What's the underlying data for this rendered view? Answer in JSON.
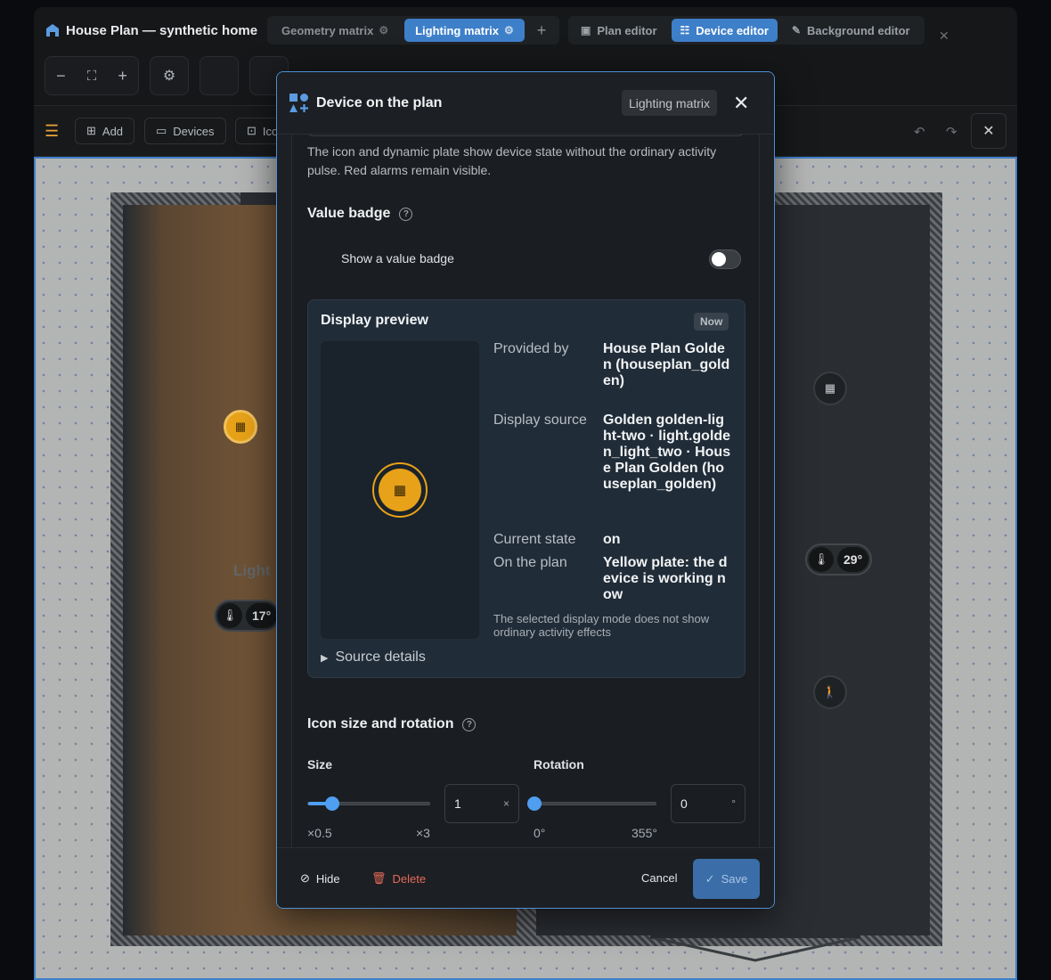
{
  "app": {
    "title": "House Plan — synthetic home",
    "matrix_tabs": [
      {
        "label": "Geometry matrix",
        "active": false
      },
      {
        "label": "Lighting matrix",
        "active": true
      }
    ],
    "modes": [
      {
        "label": "Plan editor",
        "active": false
      },
      {
        "label": "Device editor",
        "active": true
      },
      {
        "label": "Background editor",
        "active": false
      }
    ]
  },
  "toolbar": {
    "zoom_out": "−",
    "zoom_in": "+",
    "add_label": "Add",
    "devices_label": "Devices",
    "icons_label": "Icons"
  },
  "plan": {
    "room_label": "Light",
    "left_temp": "17°",
    "right_temp": "29°"
  },
  "modal": {
    "title": "Device on the plan",
    "chip": "Lighting matrix",
    "note": "The icon and dynamic plate show device state without the ordinary activity pulse. Red alarms remain visible.",
    "badge_section": "Value badge",
    "badge_toggle_label": "Show a value badge",
    "badge_toggle_on": false,
    "preview": {
      "title": "Display preview",
      "badge": "Now",
      "rows": [
        {
          "key": "Provided by",
          "value": "House Plan Golden (houseplan_golden)"
        },
        {
          "key": "Display source",
          "value": "Golden golden-light-two · light.golden_light_two · House Plan Golden (houseplan_golden)"
        },
        {
          "key": "Current state",
          "value": "on"
        },
        {
          "key": "On the plan",
          "value": "Yellow plate: the device is working now"
        }
      ],
      "note": "The selected display mode does not show ordinary activity effects",
      "details": "Source details"
    },
    "size_section": "Icon size and rotation",
    "size": {
      "label": "Size",
      "value": "1",
      "unit": "×",
      "min_label": "×0.5",
      "max_label": "×3",
      "min": 0.5,
      "max": 3,
      "current": 1
    },
    "rotation": {
      "label": "Rotation",
      "value": "0",
      "unit": "°",
      "min_label": "0°",
      "max_label": "355°",
      "min": 0,
      "max": 355,
      "current": 0
    },
    "footer": {
      "hide": "Hide",
      "delete": "Delete",
      "cancel": "Cancel",
      "save": "Save"
    }
  },
  "colors": {
    "accent": "#3e7fc9",
    "device_active": "#e8a219",
    "danger": "#e46a57"
  }
}
